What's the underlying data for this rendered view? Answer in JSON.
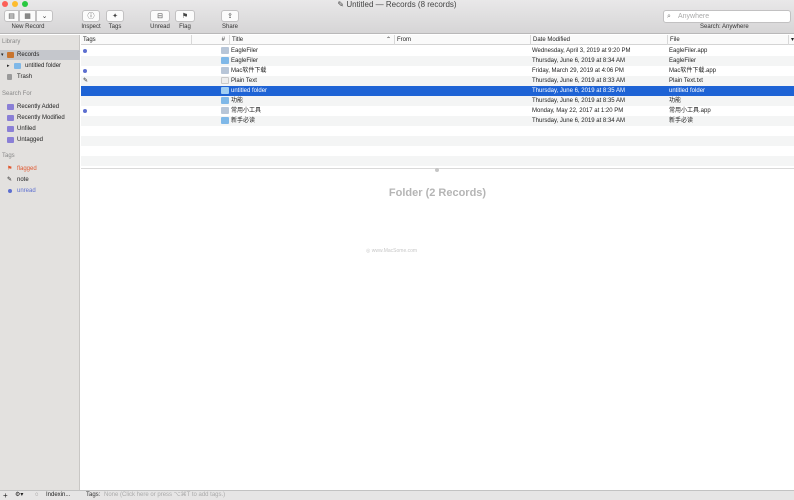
{
  "window": {
    "title": "Untitled — Records (8 records)"
  },
  "toolbar": {
    "new_record_label": "New Record",
    "inspect_label": "Inspect",
    "tags_label": "Tags",
    "unread_label": "Unread",
    "flag_label": "Flag",
    "share_label": "Share",
    "search_placeholder": "Anywhere",
    "search_scope_label": "Search: Anywhere"
  },
  "sidebar": {
    "library_header": "Library",
    "library_items": [
      {
        "label": "Records"
      },
      {
        "label": "untitled folder"
      },
      {
        "label": "Trash"
      }
    ],
    "search_header": "Search For",
    "search_items": [
      {
        "label": "Recently Added"
      },
      {
        "label": "Recently Modified"
      },
      {
        "label": "Unfiled"
      },
      {
        "label": "Untagged"
      }
    ],
    "tags_header": "Tags",
    "tag_items": [
      {
        "label": "flagged",
        "color": "#e0572f"
      },
      {
        "label": "note",
        "color": "#444444"
      },
      {
        "label": "unread",
        "color": "#5d6fd0"
      }
    ]
  },
  "table": {
    "columns": {
      "tags": "Tags",
      "number": "#",
      "title": "Title",
      "from": "From",
      "date_modified": "Date Modified",
      "file": "File"
    },
    "rows": [
      {
        "title": "EagleFiler",
        "date": "Wednesday, April 3, 2019 at 9:20 PM",
        "file": "EagleFiler.app",
        "mark": "unread",
        "icon": "app-icon"
      },
      {
        "title": "EagleFiler",
        "date": "Thursday, June 6, 2019 at 8:34 AM",
        "file": "EagleFiler",
        "mark": "",
        "icon": "folder-icon"
      },
      {
        "title": "Mac软件下载",
        "date": "Friday, March 29, 2019 at 4:06 PM",
        "file": "Mac软件下载.app",
        "mark": "unread",
        "icon": "app-icon"
      },
      {
        "title": "Plain Text",
        "date": "Thursday, June 6, 2019 at 8:33 AM",
        "file": "Plain Text.txt",
        "mark": "note",
        "icon": "text-file-icon"
      },
      {
        "title": "untitled folder",
        "date": "Thursday, June 6, 2019 at 8:35 AM",
        "file": "untitled folder",
        "mark": "",
        "icon": "folder-icon"
      },
      {
        "title": "功能",
        "date": "Thursday, June 6, 2019 at 8:35 AM",
        "file": "功能",
        "mark": "",
        "icon": "folder-icon"
      },
      {
        "title": "常用小工具",
        "date": "Monday, May 22, 2017 at 1:20 PM",
        "file": "常用小工具.app",
        "mark": "unread",
        "icon": "app-icon"
      },
      {
        "title": "新手必读",
        "date": "Thursday, June 6, 2019 at 8:34 AM",
        "file": "新手必读",
        "mark": "",
        "icon": "folder-icon"
      }
    ]
  },
  "preview": {
    "title": "Folder (2 Records)",
    "watermark": "www.MacSome.com"
  },
  "statusbar": {
    "indexing_label": "Indexin...",
    "tags_label": "Tags:",
    "tags_placeholder": "None (Click here or press ⌥⌘T to add tags.)"
  }
}
